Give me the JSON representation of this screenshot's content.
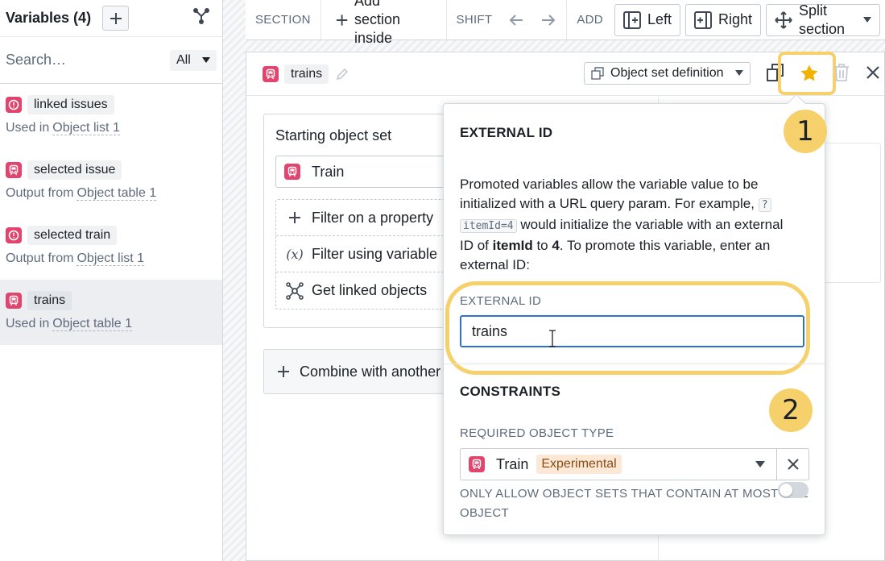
{
  "sidebar": {
    "title": "Variables (4)",
    "search_placeholder": "Search…",
    "filter": "All",
    "items": [
      {
        "name": "linked issues",
        "meta_prefix": "Used in",
        "meta_link": "Object list 1",
        "icon": "alert-icon"
      },
      {
        "name": "selected issue",
        "meta_prefix": "Output from",
        "meta_link": "Object table 1",
        "icon": "train-icon"
      },
      {
        "name": "selected train",
        "meta_prefix": "Output from",
        "meta_link": "Object list 1",
        "icon": "alert-icon"
      },
      {
        "name": "trains",
        "meta_prefix": "Used in",
        "meta_link": "Object table 1",
        "icon": "train-icon"
      }
    ]
  },
  "toolbar": {
    "section_label": "SECTION",
    "add_section_line1": "Add section",
    "add_section_line2": "inside",
    "shift_label": "SHIFT",
    "add_label": "ADD",
    "left_label": "Left",
    "right_label": "Right",
    "split_line1": "Split",
    "split_line2": "section"
  },
  "panel": {
    "variable_name": "trains",
    "definition_select": "Object set definition",
    "starting_set_title": "Starting object set",
    "object_type": "Train",
    "ops": [
      {
        "glyph": "+",
        "label": "Filter on a property"
      },
      {
        "glyph": "(x)",
        "label": "Filter using variable"
      },
      {
        "glyph": "link",
        "label": "Get linked objects"
      }
    ],
    "combine": "Combine with another"
  },
  "popover": {
    "heading": "EXTERNAL ID",
    "desc_a": "Promoted variables allow the variable value to be initialized with a URL query param. For example,",
    "code_a": "?",
    "code_b": "itemId=4",
    "desc_b": "would initialize the variable with an external ID of",
    "bold_a": "itemId",
    "desc_c": "to",
    "bold_b": "4",
    "desc_d": ". To promote this variable, enter an external ID:",
    "field_label": "EXTERNAL ID",
    "field_value": "trains",
    "constraints_heading": "CONSTRAINTS",
    "required_label": "REQUIRED OBJECT TYPE",
    "required_value": "Train",
    "required_tag": "Experimental",
    "only_allow_line1": "ONLY ALLOW OBJECT SETS THAT CONTAIN AT MOST ONE",
    "only_allow_line2": "OBJECT"
  },
  "callouts": {
    "one": "1",
    "two": "2"
  },
  "colors": {
    "accent": "#2d72d2",
    "highlight": "#f6d16b",
    "pink": "#e1456e",
    "star": "#f0b400"
  }
}
